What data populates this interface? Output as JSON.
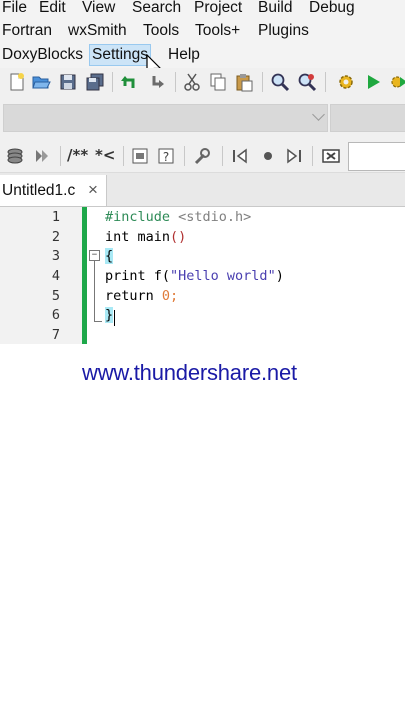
{
  "menubar": {
    "row1": [
      "File",
      "Edit",
      "View",
      "Search",
      "Project",
      "Build",
      "Debug"
    ],
    "row2": [
      "Fortran",
      "wxSmith",
      "Tools",
      "Tools+",
      "Plugins"
    ],
    "row3": [
      "DoxyBlocks",
      "Settings",
      "Help"
    ],
    "hovered": "Settings"
  },
  "toolbar1": {
    "icons": [
      "new-file-icon",
      "open-folder-icon",
      "save-icon",
      "save-all-icon",
      "undo-icon",
      "redo-icon",
      "cut-icon",
      "copy-icon",
      "paste-icon",
      "find-icon",
      "replace-icon",
      "build-gear-icon",
      "run-icon",
      "build-run-icon"
    ]
  },
  "toolbar2": {
    "comment_block_label": "/**",
    "comment_line_label": "*<"
  },
  "tab": {
    "label": "Untitled1.c",
    "close": "×"
  },
  "editor": {
    "line_numbers": [
      "1",
      "2",
      "3",
      "4",
      "5",
      "6",
      "7"
    ],
    "lines": {
      "l1_directive": "#include",
      "l1_header": " <stdio.h>",
      "l2_text": "int main",
      "l2_parens": "()",
      "l3_brace": "{",
      "l4_text": "print f(",
      "l4_string": "\"Hello world\"",
      "l4_close": ")",
      "l5_text": "return ",
      "l5_num": "0",
      "l5_semi": ";",
      "l6_brace": "}"
    }
  },
  "watermark": "www.thundershare.net",
  "colors": {
    "change_bar": "#1ea84a",
    "watermark": "#1a1aa6",
    "brace_highlight": "#a9e9f5",
    "menu_hover": "#cce4f7"
  }
}
